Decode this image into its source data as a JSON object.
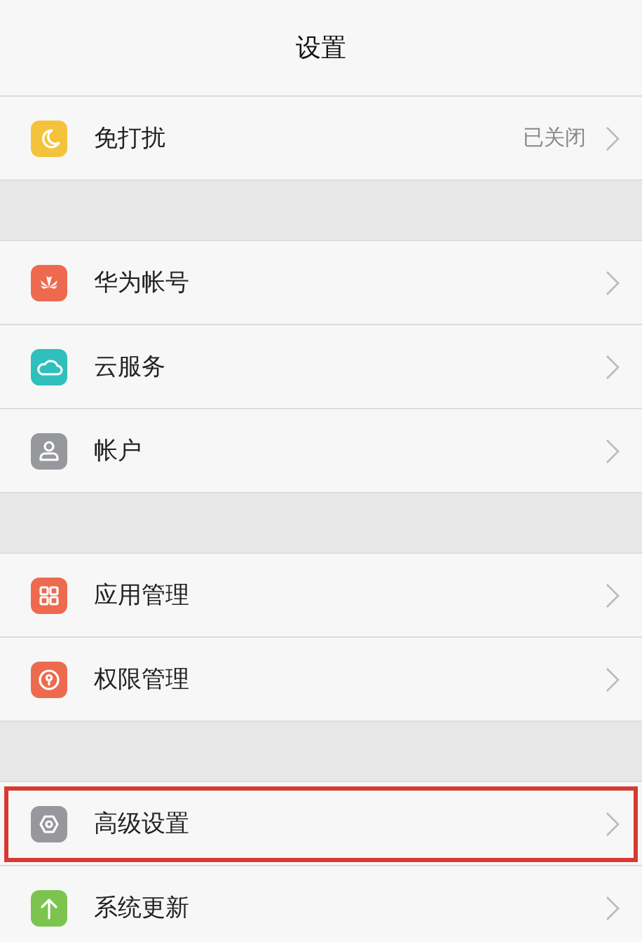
{
  "header": {
    "title": "设置"
  },
  "groups": [
    {
      "items": [
        {
          "kind": "moon",
          "color": "#f5c33b",
          "label": "免打扰",
          "value": "已关闭",
          "highlighted": false
        }
      ]
    },
    {
      "items": [
        {
          "kind": "huawei",
          "color": "#ee6a4f",
          "label": "华为帐号",
          "highlighted": false
        },
        {
          "kind": "cloud",
          "color": "#2fbfbc",
          "label": "云服务",
          "highlighted": false
        },
        {
          "kind": "person",
          "color": "#97989c",
          "label": "帐户",
          "highlighted": false
        }
      ]
    },
    {
      "items": [
        {
          "kind": "grid",
          "color": "#ee6a4f",
          "label": "应用管理",
          "highlighted": false
        },
        {
          "kind": "lock",
          "color": "#ee6a4f",
          "label": "权限管理",
          "highlighted": false
        }
      ]
    },
    {
      "items": [
        {
          "kind": "gear",
          "color": "#97989c",
          "label": "高级设置",
          "highlighted": true
        },
        {
          "kind": "arrow",
          "color": "#7cc44f",
          "label": "系统更新",
          "highlighted": false
        }
      ]
    }
  ]
}
